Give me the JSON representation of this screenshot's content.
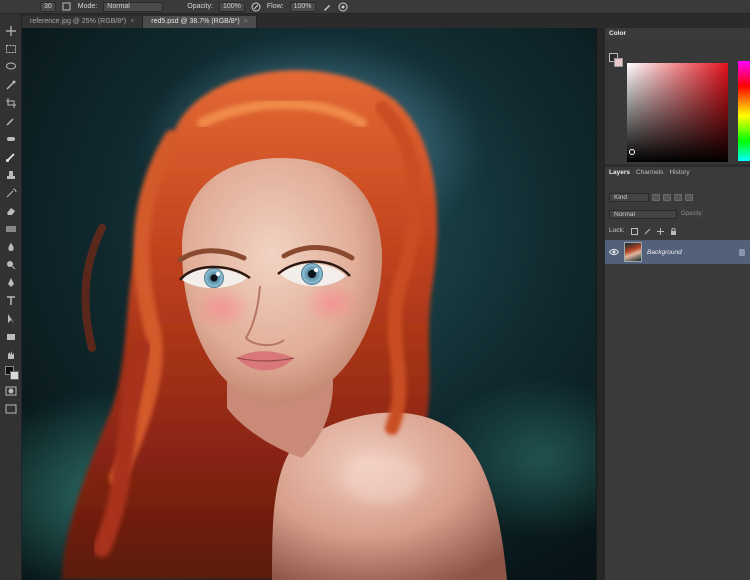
{
  "options_bar": {
    "mode_label": "Mode:",
    "mode_value": "Normal",
    "opacity_label": "Opacity:",
    "opacity_value": "100%",
    "flow_label": "Flow:",
    "flow_value": "100%",
    "brush_size": "30"
  },
  "tabs": [
    {
      "label": "reference.jpg @ 25% (RGB/8*)",
      "active": false
    },
    {
      "label": "red5.psd @ 38.7% (RGB/8*)",
      "active": true
    }
  ],
  "tab_close_glyph": "×",
  "color_panel": {
    "tab_label": "Color",
    "hue_accent": "#e3121a"
  },
  "layers_panel": {
    "tabs": [
      "Layers",
      "Channels",
      "History"
    ],
    "kind_filter": "Kind",
    "blend_mode": "Normal",
    "opacity_label": "Opacity:",
    "lock_label": "Lock:",
    "layers": [
      {
        "name": "Background",
        "visible": true,
        "locked": true
      }
    ]
  },
  "colors": {
    "selected_layer": "#52607a",
    "canvas_bg": "#0f2328",
    "hair": "#b53a1c"
  }
}
